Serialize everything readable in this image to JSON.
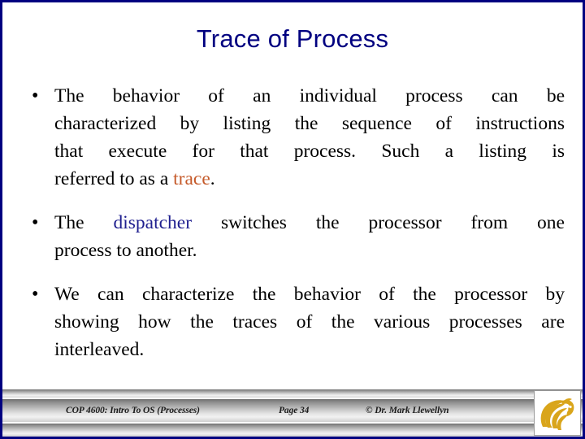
{
  "slide": {
    "title": "Trace of Process",
    "title_color": "#000080",
    "border_color": "#000080",
    "background_color": "#ffffff"
  },
  "bullets": [
    {
      "marker": "•",
      "lines": [
        "The behavior of an individual process can be",
        "characterized by listing the sequence of instructions",
        "that execute for that process.   Such a listing is",
        "referred to as a "
      ],
      "highlight": {
        "text": "trace",
        "color": "#c55a2a"
      },
      "tail": ".",
      "full_text": "The behavior of an individual process can be characterized by listing the sequence of instructions that execute for that process.  Such a listing is referred to as a trace."
    },
    {
      "marker": "•",
      "line1_prefix": "The ",
      "highlight": {
        "text": "dispatcher",
        "color": "#1f1f8f"
      },
      "line1_suffix": " switches the processor from one",
      "line2": "process to another.",
      "full_text": "The dispatcher switches the processor from one process to another."
    },
    {
      "marker": "•",
      "lines": [
        "We can characterize the behavior of the processor by",
        "showing how the traces of the various processes are",
        "interleaved."
      ],
      "full_text": "We can characterize the behavior of the processor by showing how the traces of the various processes are interleaved."
    }
  ],
  "footer": {
    "course": "COP 4600: Intro To OS  (Processes)",
    "page": "Page 34",
    "copyright": "© Dr. Mark Llewellyn",
    "band_color_light": "#f2f2f2",
    "band_color_dark": "#6f6f6f"
  },
  "logo": {
    "name": "ucf-pegasus-logo",
    "color": "#d9a51b"
  }
}
